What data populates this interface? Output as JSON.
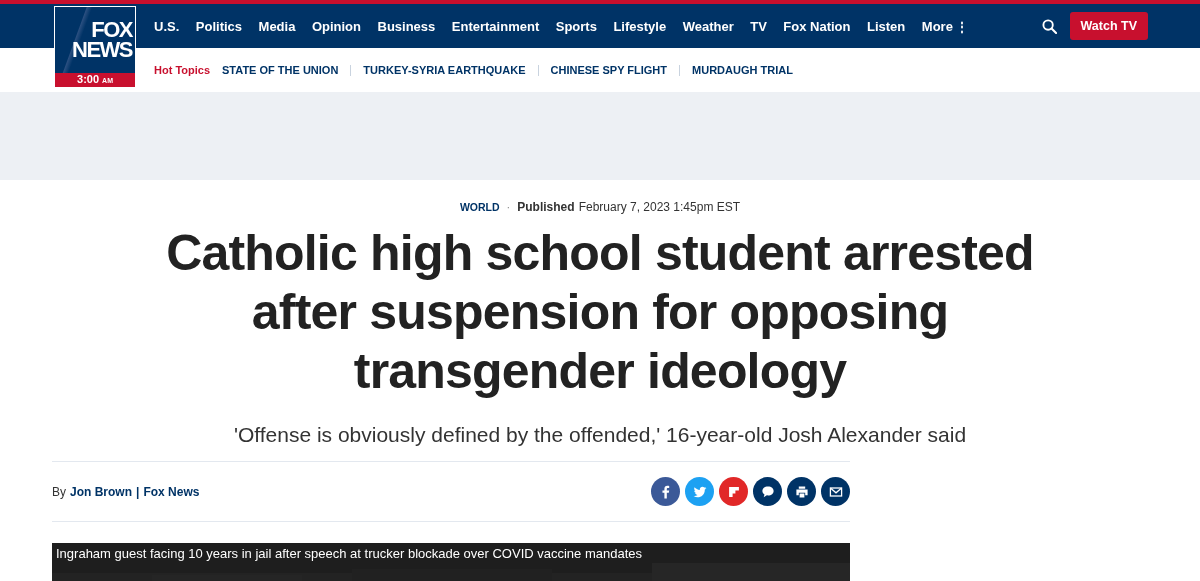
{
  "logo": {
    "line_1": "FOX",
    "line_2": "NEWS",
    "time": "3:00",
    "time_suffix": "AM"
  },
  "nav": {
    "items": [
      "U.S.",
      "Politics",
      "Media",
      "Opinion",
      "Business",
      "Entertainment",
      "Sports",
      "Lifestyle",
      "Weather",
      "TV",
      "Fox Nation",
      "Listen"
    ],
    "more": "More",
    "more_icon": "⋮",
    "watch_button": "Watch TV"
  },
  "hot_topics": {
    "label": "Hot Topics",
    "items": [
      "STATE OF THE UNION",
      "TURKEY-SYRIA EARTHQUAKE",
      "CHINESE SPY FLIGHT",
      "MURDAUGH TRIAL"
    ]
  },
  "article": {
    "section": "WORLD",
    "separator": "·",
    "published_label": "Published",
    "published_date": "February 7, 2023 1:45pm EST",
    "headline": "Catholic high school student arrested after suspension for opposing transgender ideology",
    "subheadline": "'Offense is obviously defined by the offended,' 16-year-old Josh Alexander said",
    "byline_prefix": "By",
    "author": "Jon Brown",
    "byline_separator": "|",
    "outlet": "Fox News",
    "share": [
      {
        "kind": "facebook",
        "color": "#3b5998"
      },
      {
        "kind": "twitter",
        "color": "#1da1f2"
      },
      {
        "kind": "flipboard",
        "color": "#e12828"
      },
      {
        "kind": "comment",
        "color": "#003366"
      },
      {
        "kind": "print",
        "color": "#003366"
      },
      {
        "kind": "email",
        "color": "#003366"
      }
    ],
    "video": {
      "kind": "picture",
      "caption": "Ingraham guest facing 10 years in jail after speech at trucker blockade over COVID vaccine mandates"
    }
  }
}
